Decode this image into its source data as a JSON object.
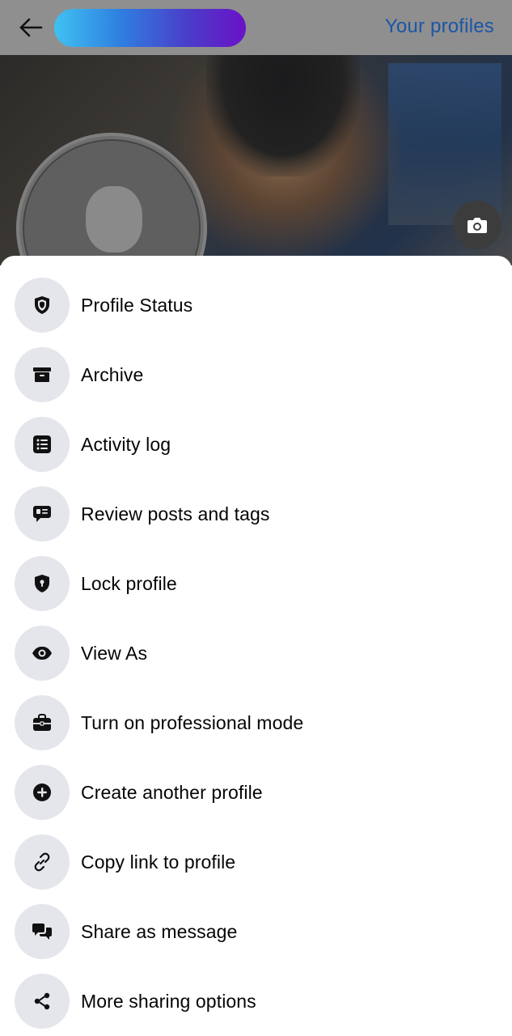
{
  "header": {
    "back_icon": "arrow-left-icon",
    "name_pill_gradient": [
      "#3fc2f2",
      "#2f7ee0",
      "#4b3cc9",
      "#6a12c7"
    ],
    "profiles_link": "Your profiles",
    "profiles_link_color": "#1a56a8"
  },
  "cover": {
    "camera_icon": "camera-icon"
  },
  "menu": {
    "items": [
      {
        "label": "Profile Status",
        "icon": "shield-icon"
      },
      {
        "label": "Archive",
        "icon": "archive-box-icon"
      },
      {
        "label": "Activity log",
        "icon": "list-icon"
      },
      {
        "label": "Review posts and tags",
        "icon": "comment-review-icon"
      },
      {
        "label": "Lock profile",
        "icon": "lock-shield-icon"
      },
      {
        "label": "View As",
        "icon": "eye-icon"
      },
      {
        "label": "Turn on professional mode",
        "icon": "briefcase-icon"
      },
      {
        "label": "Create another profile",
        "icon": "plus-circle-icon"
      },
      {
        "label": "Copy link to profile",
        "icon": "link-icon"
      },
      {
        "label": "Share as message",
        "icon": "chat-bubbles-icon"
      },
      {
        "label": "More sharing options",
        "icon": "share-icon"
      }
    ]
  },
  "colors": {
    "icon_background": "#e4e6eb",
    "text": "#050505"
  }
}
